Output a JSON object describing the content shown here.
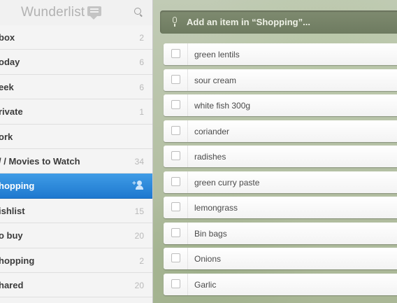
{
  "app": {
    "title": "Wunderlist"
  },
  "sidebar": {
    "items": [
      {
        "label": "box",
        "count": "2"
      },
      {
        "label": "oday",
        "count": "6"
      },
      {
        "label": "eek",
        "count": "6"
      },
      {
        "label": "rivate",
        "count": "1"
      },
      {
        "label": "ork",
        "count": ""
      },
      {
        "label": "/ / Movies to Watch",
        "count": "34"
      },
      {
        "label": "hopping",
        "count": "",
        "active": true
      },
      {
        "label": "ishlist",
        "count": "15"
      },
      {
        "label": "o buy",
        "count": "20"
      },
      {
        "label": "hopping",
        "count": "2"
      },
      {
        "label": "hared",
        "count": "20"
      }
    ]
  },
  "main": {
    "add_item_placeholder": "Add an item in “Shopping”...",
    "tasks": [
      {
        "text": "green lentils"
      },
      {
        "text": "sour cream"
      },
      {
        "text": "white fish 300g"
      },
      {
        "text": "coriander"
      },
      {
        "text": "radishes"
      },
      {
        "text": "green curry paste"
      },
      {
        "text": "lemongrass"
      },
      {
        "text": "Bin bags"
      },
      {
        "text": "Onions"
      },
      {
        "text": "Garlic"
      }
    ]
  },
  "colors": {
    "accent": "#2f8ade",
    "sidebar_bg": "#f3f3f3",
    "add_bar": "#76836a"
  },
  "icons": [
    "message-bubble-icon",
    "search-icon",
    "share-user-icon",
    "microphone-icon",
    "checkbox-icon"
  ]
}
